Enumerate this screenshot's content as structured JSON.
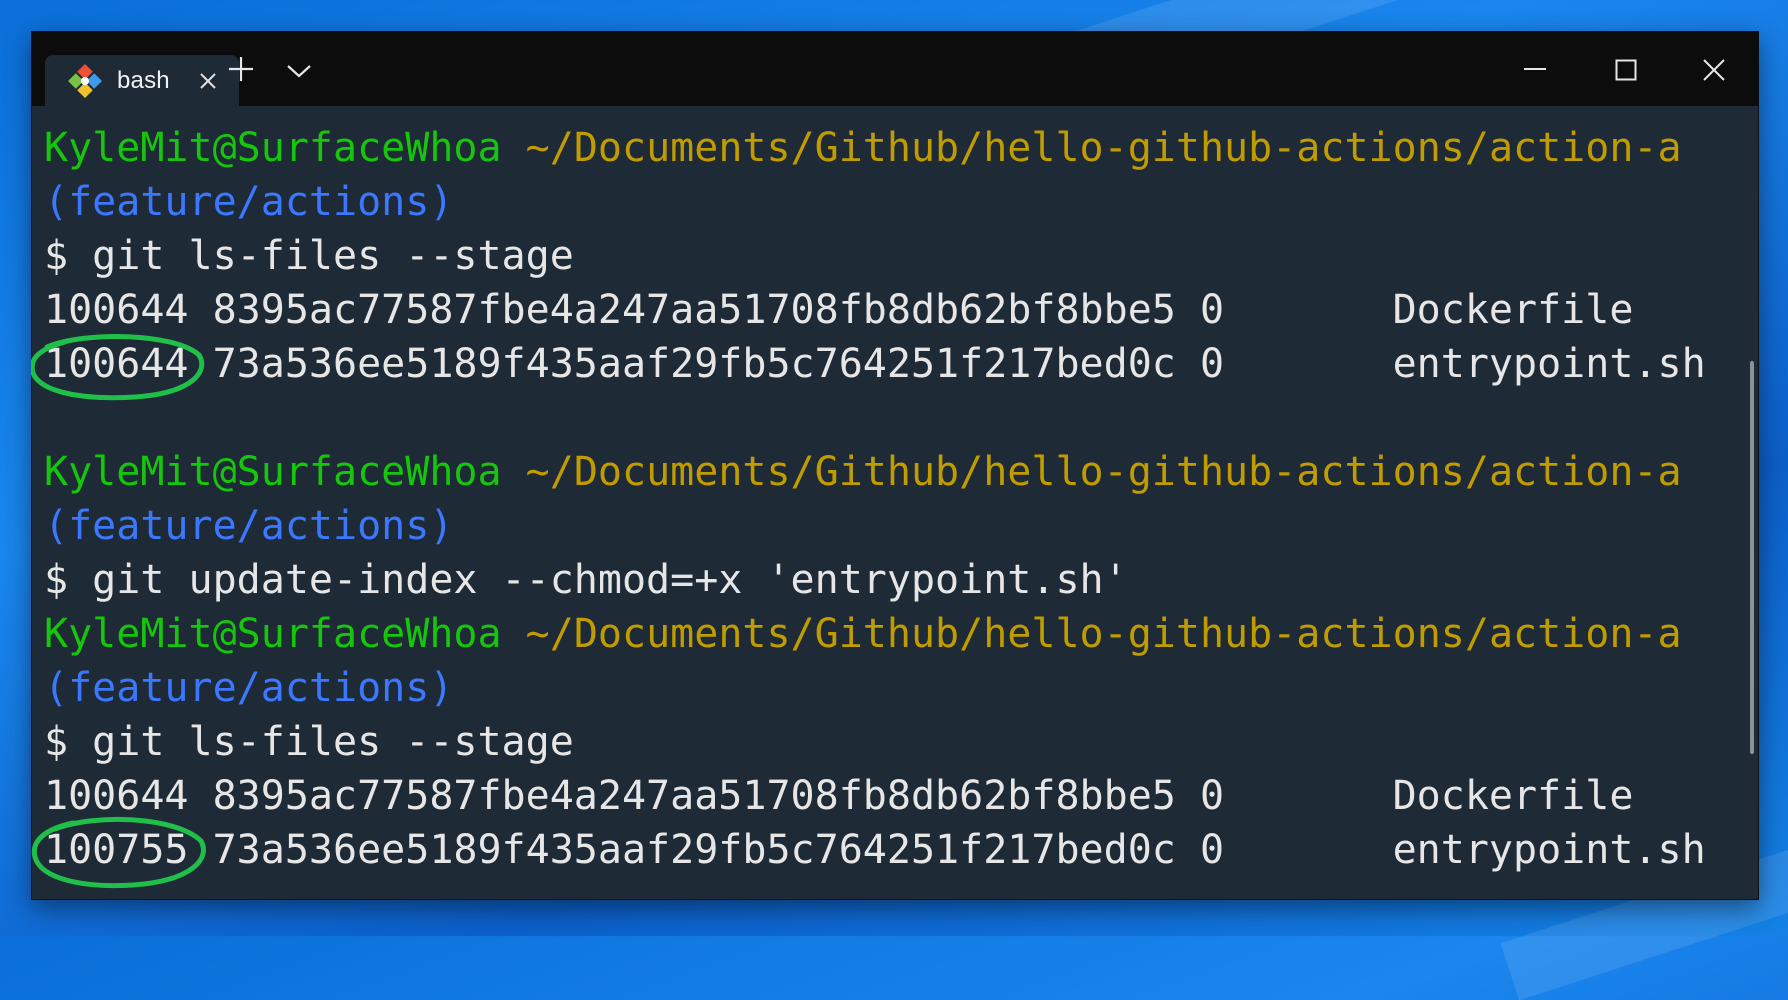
{
  "window": {
    "tabs": [
      {
        "label": "bash",
        "icon": "git-icon",
        "active": true
      }
    ],
    "new_tab_icon": "plus-icon",
    "dropdown_icon": "chevron-down-icon",
    "controls": [
      "minimize-icon",
      "maximize-icon",
      "close-icon"
    ]
  },
  "colors": {
    "user": "#16c60c",
    "path": "#c19c00",
    "branch": "#3b78ff",
    "text": "#d9d9d9",
    "background": "#1e2a36",
    "annotation": "#1fbf4a"
  },
  "terminal": {
    "lines": [
      {
        "user": "KyleMit@SurfaceWhoa",
        "path": "~/Documents/Github/hello-github-actions/action-a"
      },
      {
        "branch": "(feature/actions)"
      },
      {
        "text": "$ git ls-files --stage"
      },
      {
        "text": "100644 8395ac77587fbe4a247aa51708fb8db62bf8bbe5 0       Dockerfile"
      },
      {
        "text": "100644 73a536ee5189f435aaf29fb5c764251f217bed0c 0       entrypoint.sh"
      },
      {
        "text": ""
      },
      {
        "user": "KyleMit@SurfaceWhoa",
        "path": "~/Documents/Github/hello-github-actions/action-a"
      },
      {
        "branch": "(feature/actions)"
      },
      {
        "text": "$ git update-index --chmod=+x 'entrypoint.sh'"
      },
      {
        "user": "KyleMit@SurfaceWhoa",
        "path": "~/Documents/Github/hello-github-actions/action-a"
      },
      {
        "branch": "(feature/actions)"
      },
      {
        "text": "$ git ls-files --stage"
      },
      {
        "text": "100644 8395ac77587fbe4a247aa51708fb8db62bf8bbe5 0       Dockerfile"
      },
      {
        "text": "100755 73a536ee5189f435aaf29fb5c764251f217bed0c 0       entrypoint.sh"
      }
    ]
  }
}
